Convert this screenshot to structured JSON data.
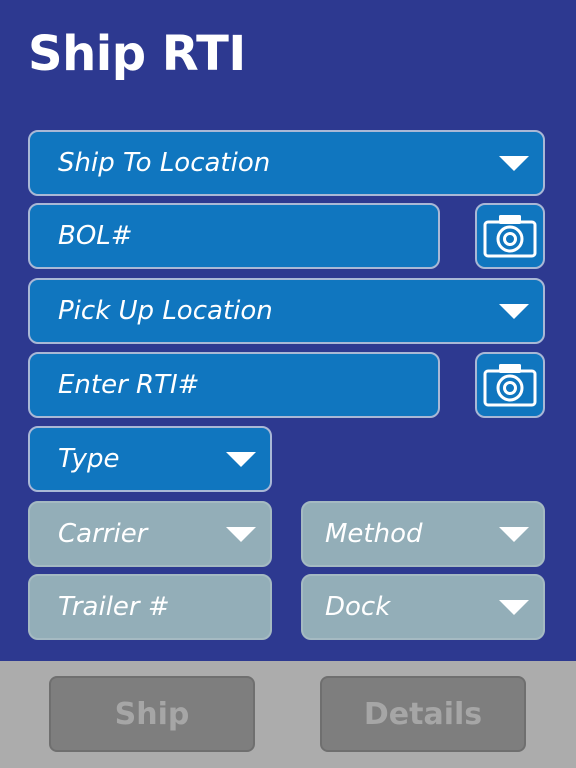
{
  "header": {
    "title": "Ship RTI"
  },
  "form": {
    "ship_to_location": {
      "label": "Ship To Location",
      "caret_icon": "chevron-down-icon"
    },
    "bol": {
      "placeholder": "BOL#",
      "scan_icon": "camera-icon"
    },
    "pick_up_location": {
      "label": "Pick Up Location",
      "caret_icon": "chevron-down-icon"
    },
    "rti": {
      "placeholder": "Enter RTI#",
      "scan_icon": "camera-icon"
    },
    "type": {
      "label": "Type"
    },
    "carrier": {
      "label": "Carrier"
    },
    "method": {
      "label": "Method"
    },
    "trailer": {
      "placeholder": "Trailer #"
    },
    "dock": {
      "label": "Dock"
    }
  },
  "footer": {
    "ship_label": "Ship",
    "details_label": "Details"
  },
  "colors": {
    "background": "#2d3990",
    "field_active": "#1076bf",
    "field_disabled": "#93aeb8",
    "footer_bg": "#acacac",
    "button_disabled": "#7e7e7e"
  }
}
